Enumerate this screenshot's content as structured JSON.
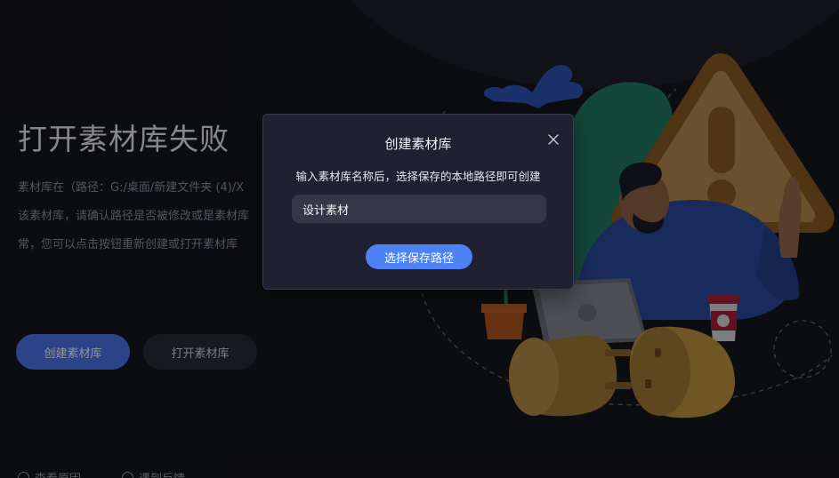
{
  "error": {
    "title": "打开素材库失败",
    "description": "素材库在（路径：G:/桌面/新建文件夹 (4)/X\n该素材库，请确认路径是否被修改或是素材库\n常，您可以点击按钮重新创建或打开素材库"
  },
  "actions": {
    "create_label": "创建素材库",
    "open_label": "打开素材库"
  },
  "footer": {
    "link1": "查看原因",
    "link2": "遇到反馈"
  },
  "modal": {
    "title": "创建素材库",
    "subtitle": "输入素材库名称后，选择保存的本地路径即可创建",
    "input_value": "设计素材",
    "button_label": "选择保存路径",
    "close_icon": "close-icon"
  },
  "colors": {
    "background": "#16171d",
    "primary": "#4d82f5",
    "modal_bg": "#1f2030",
    "warning": "#e8a93a"
  }
}
